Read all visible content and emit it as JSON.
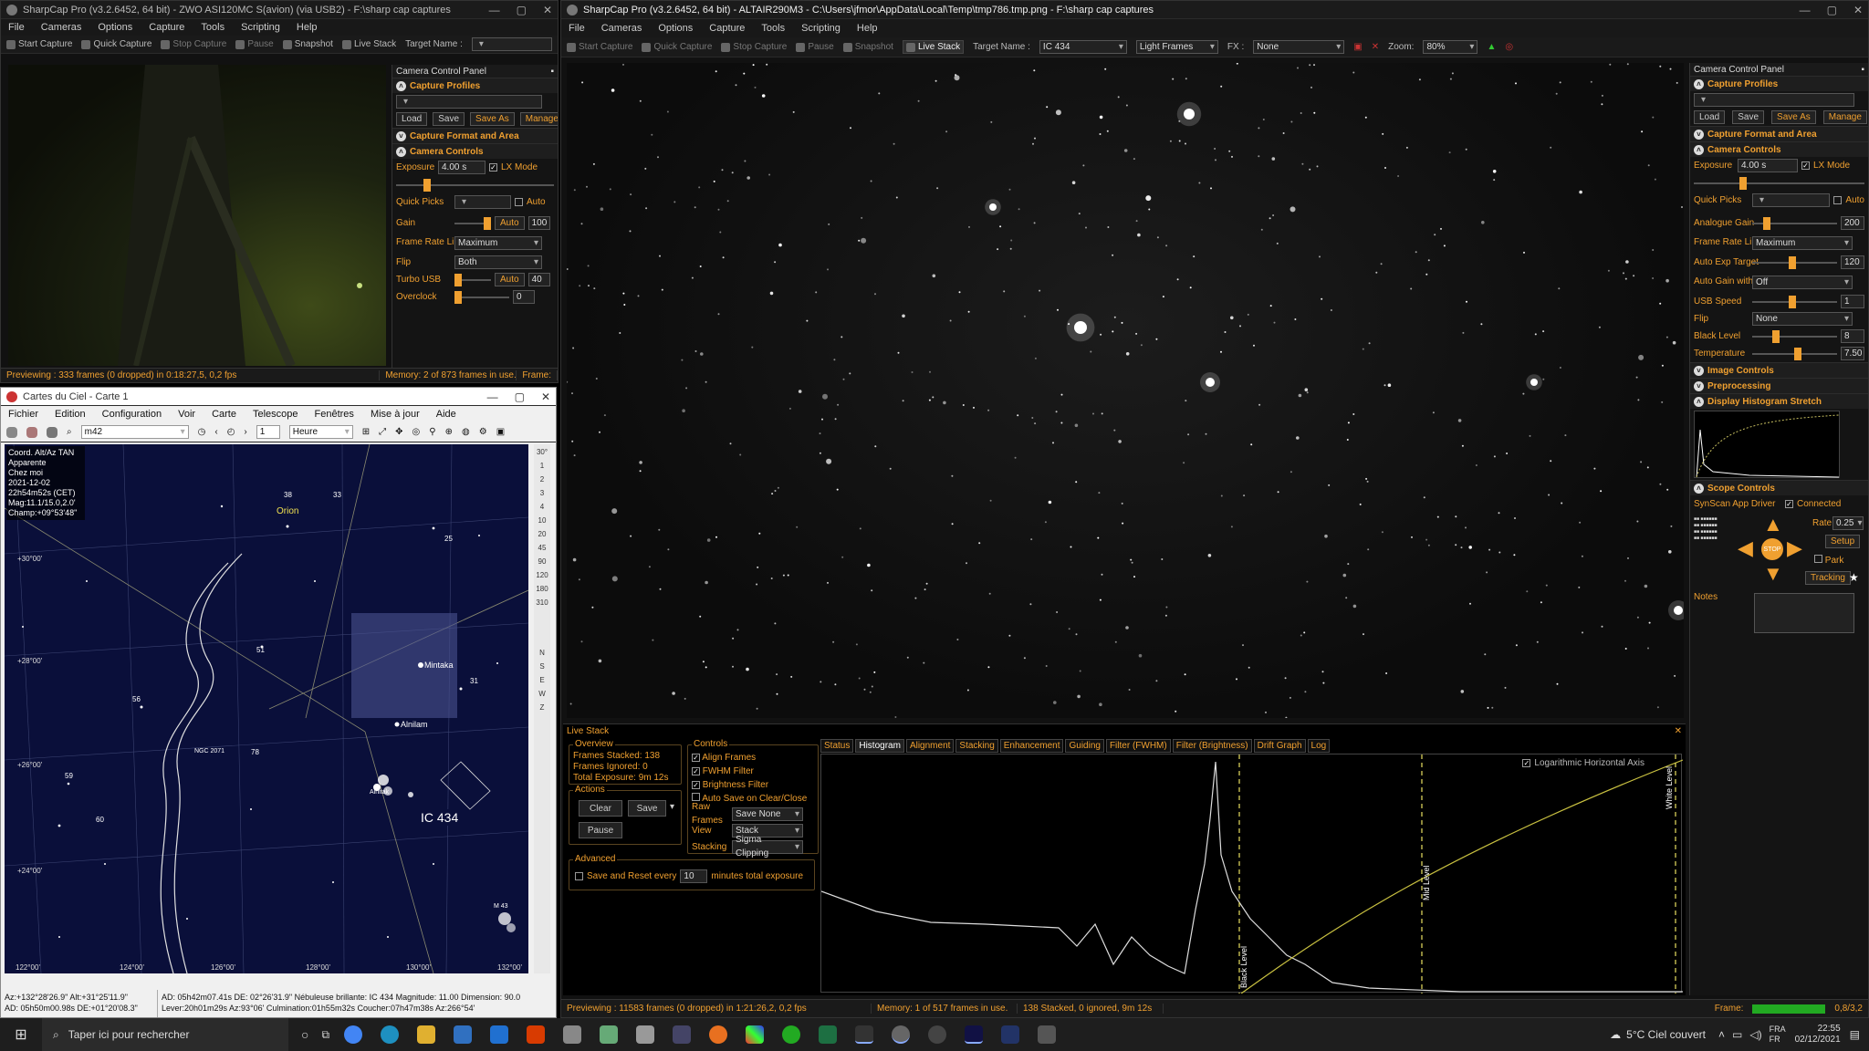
{
  "sc1": {
    "title": "SharpCap Pro (v3.2.6452, 64 bit) - ZWO ASI120MC S(avion) (via USB2) - F:\\sharp cap captures",
    "menu": [
      "File",
      "Cameras",
      "Options",
      "Capture",
      "Tools",
      "Scripting",
      "Help"
    ],
    "toolbar": {
      "start": "Start Capture",
      "quick": "Quick Capture",
      "stop": "Stop Capture",
      "pause": "Pause",
      "snapshot": "Snapshot",
      "live": "Live Stack",
      "target": "Target Name :"
    },
    "panel_title": "Camera Control Panel",
    "profiles": "Capture Profiles",
    "profile_buttons": [
      "Load",
      "Save",
      "Save As",
      "Manage"
    ],
    "format": "Capture Format and Area",
    "controls": "Camera Controls",
    "exposure_label": "Exposure",
    "exposure_value": "4.00 s",
    "lx_mode": "LX Mode",
    "quick_picks": "Quick Picks",
    "auto": "Auto",
    "gain_label": "Gain",
    "gain_value": "100",
    "frame_rate_label": "Frame Rate Limit",
    "frame_rate_value": "Maximum",
    "flip_label": "Flip",
    "flip_value": "Both",
    "turbo_label": "Turbo USB",
    "turbo_value": "40",
    "overclock_label": "Overclock",
    "overclock_value": "0",
    "status_preview": "Previewing : 333 frames (0 dropped) in 0:18:27,5, 0,2 fps",
    "status_memory": "Memory: 2 of 873 frames in use.",
    "status_frame": "Frame:"
  },
  "cdc": {
    "title": "Cartes du Ciel - Carte 1",
    "menu": [
      "Fichier",
      "Edition",
      "Configuration",
      "Voir",
      "Carte",
      "Telescope",
      "Fenêtres",
      "Mise à jour",
      "Aide"
    ],
    "search": "m42",
    "step": "1",
    "unit": "Heure",
    "info": [
      "Coord. Alt/Az TAN",
      "Apparente",
      "Chez moi",
      "2021-12-02",
      "22h54m52s (CET)",
      "Mag:11.1/15.0,2.0'",
      "Champ:+09°53'48\""
    ],
    "labels": {
      "orion": "Orion",
      "mintaka": "Mintaka",
      "alnilam": "Alnilam",
      "ngc2071": "NGC 2071",
      "ic434": "IC 434",
      "m43": "M 43",
      "alnitak": "Alnitak"
    },
    "star_nums": [
      "38",
      "33",
      "25",
      "51",
      "56",
      "59",
      "60",
      "31",
      "78",
      "1"
    ],
    "dec_labels": [
      "+30°00'",
      "+28°00'",
      "+26°00'",
      "+24°00'"
    ],
    "ra_labels": [
      "122°00'",
      "124°00'",
      "126°00'",
      "128°00'",
      "130°00'",
      "132°00'"
    ],
    "scale": [
      "30°",
      "1",
      "2",
      "3",
      "4",
      "10",
      "20",
      "45",
      "90",
      "120",
      "180",
      "310"
    ],
    "side_letters": [
      "N",
      "S",
      "E",
      "W",
      "Z"
    ],
    "status1": "Az:+132°28'26.9\" Alt:+31°25'11.9\"",
    "status2": "AD: 05h50m00.98s DE:+01°20'08.3\"",
    "status3": "AD: 05h42m07.41s DE: 02°26'31.9\"  Nébuleuse brillante: IC 434  Magnitude: 11.00  Dimension: 90.0",
    "status4": "Lever:20h01m29s Az:93°06'  Culmination:01h55m32s  Coucher:07h47m38s Az:266°54'"
  },
  "sc2": {
    "title": "SharpCap Pro (v3.2.6452, 64 bit) - ALTAIR290M3 - C:\\Users\\jfmor\\AppData\\Local\\Temp\\tmp786.tmp.png - F:\\sharp cap captures",
    "menu": [
      "File",
      "Cameras",
      "Options",
      "Capture",
      "Tools",
      "Scripting",
      "Help"
    ],
    "toolbar": {
      "start": "Start Capture",
      "quick": "Quick Capture",
      "stop": "Stop Capture",
      "pause": "Pause",
      "snapshot": "Snapshot",
      "live": "Live Stack",
      "target": "Target Name :",
      "target_value": "IC 434",
      "frames": "Light Frames",
      "fx": "FX :",
      "fx_value": "None",
      "zoom": "Zoom:",
      "zoom_value": "80%"
    },
    "panel_title": "Camera Control Panel",
    "profiles": "Capture Profiles",
    "profile_buttons": [
      "Load",
      "Save",
      "Save As",
      "Manage"
    ],
    "format": "Capture Format and Area",
    "controls": "Camera Controls",
    "exposure_label": "Exposure",
    "exposure_value": "4.00 s",
    "lx_mode": "LX Mode",
    "quick_picks": "Quick Picks",
    "auto": "Auto",
    "gain_label": "Analogue Gain",
    "gain_value": "200",
    "frame_rate_label": "Frame Rate Limit",
    "frame_rate_value": "Maximum",
    "autoexp_label": "Auto Exp Target",
    "autoexp_value": "120",
    "autogain_label": "Auto Gain with Auto Exposure",
    "autogain_value": "Off",
    "usb_label": "USB Speed",
    "usb_value": "1",
    "flip_label": "Flip",
    "flip_value": "None",
    "black_label": "Black Level",
    "black_value": "8",
    "temp_label": "Temperature",
    "temp_value": "7.50",
    "image_controls": "Image Controls",
    "preprocessing": "Preprocessing",
    "histogram": "Display Histogram Stretch",
    "scope": "Scope Controls",
    "scope_driver": "SynScan App Driver",
    "connected": "Connected",
    "rate_label": "Rate:",
    "rate_value": "0.25",
    "setup": "Setup",
    "park": "Park",
    "tracking": "Tracking",
    "stop": "STOP",
    "notes": "Notes",
    "status_preview": "Previewing : 11583 frames (0 dropped) in 1:21:26,2, 0,2 fps",
    "status_memory": "Memory: 1 of 517 frames in use.",
    "status_stack": "138 Stacked, 0 ignored, 9m 12s",
    "status_frame": "Frame:",
    "status_ratio": "0,8/3,2"
  },
  "livestack": {
    "title": "Live Stack",
    "overview": "Overview",
    "stacked": "Frames Stacked:  138",
    "ignored": "Frames Ignored:  0",
    "total": "Total Exposure:   9m 12s",
    "actions": "Actions",
    "clear": "Clear",
    "save": "Save",
    "pause": "Pause",
    "advanced": "Advanced",
    "save_reset": "Save and Reset every",
    "save_reset_value": "10",
    "save_reset_unit": "minutes total exposure",
    "controls": "Controls",
    "align": "Align Frames",
    "fwhm": "FWHM Filter",
    "brightness": "Brightness Filter",
    "autosave": "Auto Save on Clear/Close",
    "raw_label": "Raw Frames",
    "raw_value": "Save None",
    "view_label": "View",
    "view_value": "Stack",
    "stacking_label": "Stacking",
    "stacking_value": "Sigma Clipping",
    "tabs": [
      "Status",
      "Histogram",
      "Alignment",
      "Stacking",
      "Enhancement",
      "Guiding",
      "Filter (FWHM)",
      "Filter (Brightness)",
      "Drift Graph",
      "Log"
    ],
    "log_axis": "Logarithmic Horizontal Axis",
    "black_level": "Black Level",
    "mid_level": "Mid Level",
    "white_level": "White Level"
  },
  "taskbar": {
    "search": "Taper ici pour rechercher",
    "weather": "5°C  Ciel couvert",
    "lang1": "FRA",
    "lang2": "FR",
    "time": "22:55",
    "date": "02/12/2021"
  },
  "colors": {
    "accent": "#f0a030",
    "bg": "#111111",
    "sky": "#0a0f3a"
  }
}
